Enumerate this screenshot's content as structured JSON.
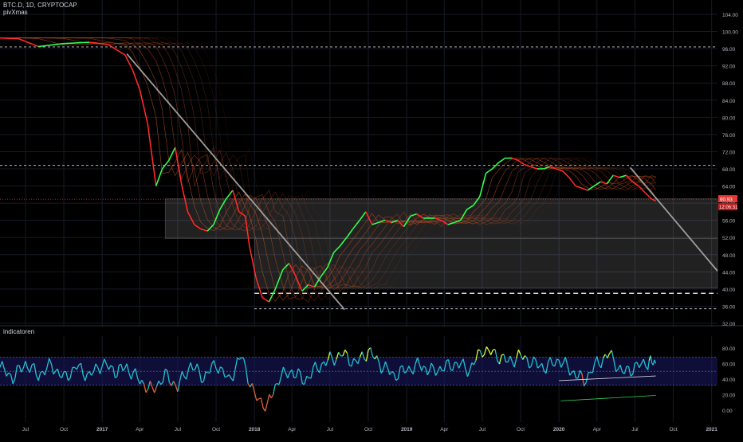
{
  "header": {
    "symbol": "BTC.D, 1D, CRYPTOCAP",
    "indicator": "pivXmas"
  },
  "sub_pane": {
    "title": "indicatoren"
  },
  "colors": {
    "background": "#000000",
    "grid": "#161a25",
    "axis_text": "#b2b5be",
    "candle_up": "#26a69a",
    "candle_down": "#ef5350",
    "ribbon_fast_up": "#22ff44",
    "ribbon_fast_down": "#ff1a1a",
    "trendline": "#9e9e9e",
    "current_price_line": "#e53935",
    "ind_line_main": "#22c0d0",
    "ind_line_hot": "#d4ff33",
    "ind_line_cold": "#e0623a",
    "ind_band": "#1a1a66"
  },
  "chart_data": [
    {
      "type": "line",
      "title": "BTC.D, 1D, CRYPTOCAP",
      "x_ticks": [
        "Jul",
        "Oct",
        "2017",
        "Apr",
        "Jul",
        "Oct",
        "2018",
        "Apr",
        "Jul",
        "Oct",
        "2019",
        "Apr",
        "Jul",
        "Oct",
        "2020",
        "Apr",
        "Jul",
        "Oct",
        "2021"
      ],
      "y_ticks": [
        "104.00",
        "100.00",
        "96.00",
        "92.00",
        "88.00",
        "84.00",
        "80.00",
        "76.00",
        "72.00",
        "68.00",
        "64.00",
        "60.00",
        "56.00",
        "52.00",
        "48.00",
        "44.00",
        "40.00",
        "36.00",
        "32.00"
      ],
      "ylim": [
        32,
        104
      ],
      "xlim": [
        "2016-05-01",
        "2021-01-15"
      ],
      "series": [
        {
          "x": [
            "2016-05-01",
            "2016-06-15",
            "2016-08-01",
            "2016-10-01",
            "2016-12-01",
            "2017-01-15",
            "2017-02-25",
            "2017-03-15",
            "2017-04-01",
            "2017-04-20",
            "2017-05-10",
            "2017-05-25",
            "2017-06-10",
            "2017-06-25",
            "2017-07-10",
            "2017-07-25",
            "2017-08-10",
            "2017-08-25",
            "2017-09-10",
            "2017-09-25",
            "2017-10-10",
            "2017-10-25",
            "2017-11-10",
            "2017-11-25",
            "2017-12-10",
            "2017-12-20",
            "2018-01-05",
            "2018-01-20",
            "2018-02-05",
            "2018-02-20",
            "2018-03-10",
            "2018-03-25",
            "2018-04-10",
            "2018-04-25",
            "2018-05-10",
            "2018-05-25",
            "2018-06-10",
            "2018-06-25",
            "2018-07-10",
            "2018-07-25",
            "2018-08-10",
            "2018-08-25",
            "2018-09-10",
            "2018-09-25",
            "2018-10-10",
            "2018-10-25",
            "2018-11-10",
            "2018-11-25",
            "2018-12-10",
            "2018-12-25",
            "2019-01-10",
            "2019-01-25",
            "2019-02-10",
            "2019-02-25",
            "2019-03-10",
            "2019-03-25",
            "2019-04-10",
            "2019-04-25",
            "2019-05-10",
            "2019-05-25",
            "2019-06-10",
            "2019-06-25",
            "2019-07-10",
            "2019-07-25",
            "2019-08-10",
            "2019-08-25",
            "2019-09-10",
            "2019-09-25",
            "2019-10-10",
            "2019-10-25",
            "2019-11-10",
            "2019-11-25",
            "2019-12-10",
            "2019-12-25",
            "2020-01-10",
            "2020-01-25",
            "2020-02-10",
            "2020-02-25",
            "2020-03-10",
            "2020-03-25",
            "2020-04-10",
            "2020-04-25",
            "2020-05-10",
            "2020-05-25",
            "2020-06-10",
            "2020-06-25",
            "2020-07-10",
            "2020-07-25",
            "2020-08-10",
            "2020-08-20"
          ],
          "y": [
            98.5,
            98.3,
            96.5,
            97.2,
            97.5,
            97.0,
            94.5,
            91.0,
            86.5,
            78.5,
            64.0,
            68.0,
            70.0,
            73.0,
            64.5,
            58.0,
            55.0,
            54.0,
            53.5,
            55.0,
            58.5,
            61.0,
            63.0,
            58.0,
            57.0,
            50.0,
            42.5,
            38.0,
            37.0,
            40.0,
            44.5,
            46.0,
            43.0,
            39.5,
            41.0,
            40.5,
            43.0,
            45.0,
            48.5,
            50.0,
            52.0,
            54.0,
            56.0,
            58.0,
            55.0,
            55.5,
            56.0,
            55.5,
            56.0,
            54.5,
            57.0,
            57.5,
            56.5,
            56.5,
            56.5,
            56.0,
            55.0,
            55.5,
            56.0,
            58.5,
            59.5,
            61.5,
            67.0,
            68.0,
            69.5,
            70.5,
            70.5,
            70.0,
            69.0,
            68.5,
            68.0,
            68.0,
            68.5,
            68.0,
            67.5,
            66.0,
            64.0,
            63.5,
            63.0,
            64.0,
            65.0,
            64.5,
            66.5,
            66.0,
            66.5,
            65.0,
            64.0,
            62.5,
            61.0,
            60.5
          ]
        }
      ],
      "price_tag": "60.93",
      "countdown_tag": "12:06:31",
      "horizontal_levels": [
        96.4,
        68.8,
        39.0,
        35.4
      ],
      "zones": [
        {
          "from": "2017-06-01",
          "to": "2021-01-15",
          "top": 61.0,
          "bottom": 51.8
        },
        {
          "from": "2018-01-01",
          "to": "2021-01-15",
          "top": 51.8,
          "bottom": 40.2
        }
      ],
      "trendlines": [
        {
          "x": [
            "2017-03-01",
            "2018-08-05"
          ],
          "y": [
            94.8,
            35.2
          ]
        },
        {
          "x": [
            "2020-06-20",
            "2021-01-15"
          ],
          "y": [
            68.3,
            44.2
          ]
        }
      ]
    },
    {
      "type": "line",
      "title": "indicatoren",
      "y_ticks": [
        "80.00",
        "60.00",
        "40.00",
        "20.00",
        "0.00"
      ],
      "ylim": [
        -5,
        87
      ],
      "band": [
        32,
        68
      ],
      "series": [
        {
          "x": [
            "2016-05-01",
            "2016-06-01",
            "2016-07-01",
            "2016-08-01",
            "2016-09-01",
            "2016-10-01",
            "2016-11-01",
            "2016-12-01",
            "2017-01-01",
            "2017-02-01",
            "2017-03-01",
            "2017-04-01",
            "2017-05-01",
            "2017-06-01",
            "2017-07-01",
            "2017-08-01",
            "2017-09-01",
            "2017-10-01",
            "2017-11-01",
            "2017-12-01",
            "2018-01-01",
            "2018-02-01",
            "2018-03-01",
            "2018-04-01",
            "2018-05-01",
            "2018-06-01",
            "2018-07-01",
            "2018-08-01",
            "2018-09-01",
            "2018-10-01",
            "2018-11-01",
            "2018-12-01",
            "2019-01-01",
            "2019-02-01",
            "2019-03-01",
            "2019-04-01",
            "2019-05-01",
            "2019-06-01",
            "2019-07-01",
            "2019-08-01",
            "2019-09-01",
            "2019-10-01",
            "2019-11-01",
            "2019-12-01",
            "2020-01-01",
            "2020-02-01",
            "2020-03-01",
            "2020-04-01",
            "2020-05-01",
            "2020-06-01",
            "2020-07-01",
            "2020-08-01",
            "2020-08-20"
          ],
          "y": [
            55,
            42,
            60,
            45,
            58,
            41,
            56,
            44,
            60,
            50,
            55,
            38,
            25,
            45,
            30,
            58,
            42,
            60,
            38,
            70,
            18,
            5,
            42,
            50,
            38,
            55,
            65,
            72,
            60,
            76,
            58,
            45,
            52,
            58,
            50,
            55,
            60,
            52,
            78,
            72,
            62,
            70,
            60,
            55,
            65,
            50,
            38,
            60,
            72,
            48,
            55,
            62,
            60
          ]
        }
      ],
      "guide_lines": [
        {
          "x": [
            "2020-01-05",
            "2020-08-20"
          ],
          "y": [
            12,
            19
          ]
        },
        {
          "x": [
            "2020-01-01",
            "2020-08-20"
          ],
          "y": [
            38,
            44
          ]
        }
      ]
    }
  ]
}
